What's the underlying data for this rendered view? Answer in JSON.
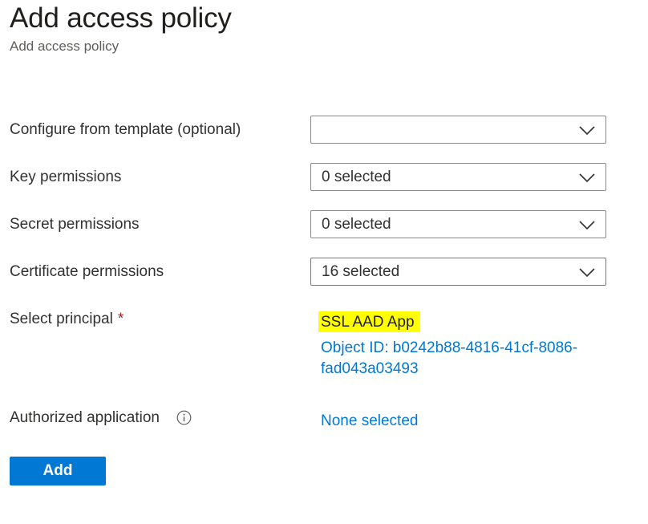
{
  "header": {
    "title": "Add access policy",
    "subtitle": "Add access policy"
  },
  "form": {
    "template": {
      "label": "Configure from template (optional)",
      "value": ""
    },
    "key_permissions": {
      "label": "Key permissions",
      "value": "0 selected"
    },
    "secret_permissions": {
      "label": "Secret permissions",
      "value": "0 selected"
    },
    "certificate_permissions": {
      "label": "Certificate permissions",
      "value": "16 selected"
    },
    "principal": {
      "label": "Select principal",
      "required_marker": "*",
      "name": "SSL AAD App",
      "object_id_line1": "Object ID: b0242b88-4816-41cf-8086-",
      "object_id_line2": "fad043a03493"
    },
    "authorized_application": {
      "label": "Authorized application",
      "info_icon": "info-icon",
      "value": "None selected"
    }
  },
  "actions": {
    "add_label": "Add"
  },
  "icons": {
    "dropdown": "chevron-down-icon"
  },
  "colors": {
    "accent": "#0078d4",
    "highlight": "#ffff00",
    "required": "#a4262c",
    "active_border": "#8764b8"
  }
}
